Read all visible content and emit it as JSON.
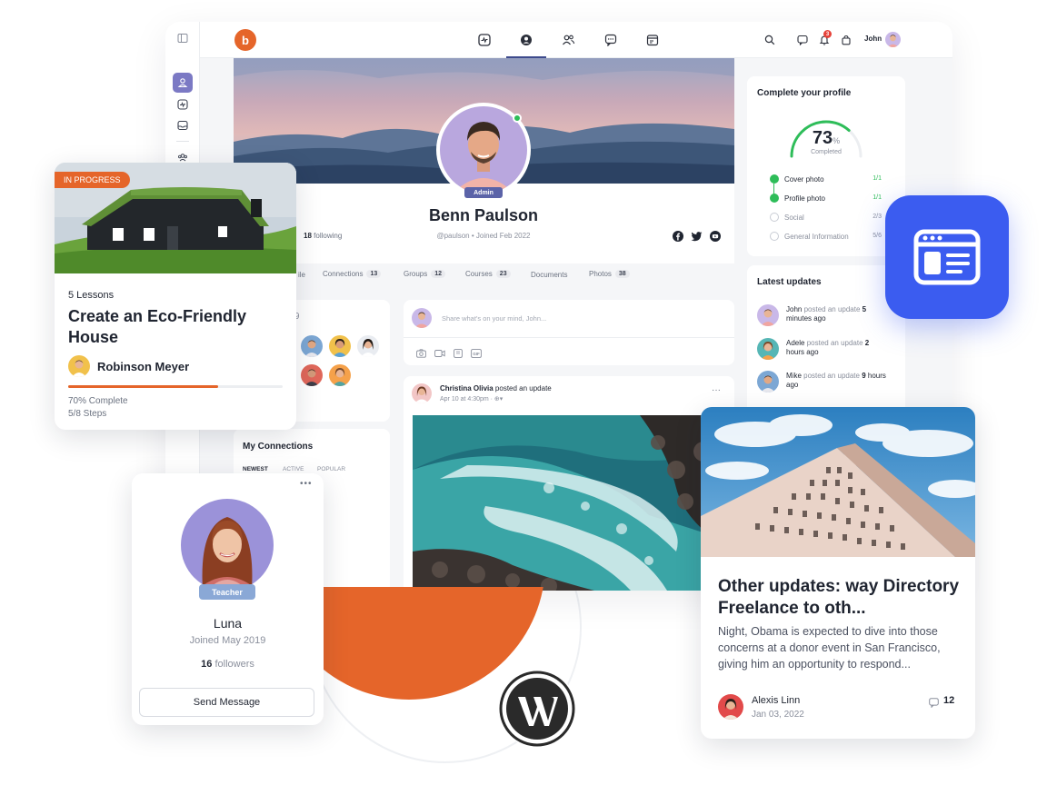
{
  "topbar": {
    "logo_letter": "b",
    "user_name": "John",
    "notification_count": "3"
  },
  "profile": {
    "name": "Benn Paulson",
    "handle": "@paulson",
    "joined": "Joined Feb 2022",
    "role_badge": "Admin",
    "following_count": "18",
    "following_label": "following"
  },
  "tabs": [
    {
      "label": "ile",
      "count": ""
    },
    {
      "label": "Connections",
      "count": "13"
    },
    {
      "label": "Groups",
      "count": "12"
    },
    {
      "label": "Courses",
      "count": "23"
    },
    {
      "label": "Documents",
      "count": ""
    },
    {
      "label": "Photos",
      "count": "38"
    }
  ],
  "following_widget": {
    "title_partial": "g",
    "count": "9"
  },
  "composer": {
    "placeholder": "Share what's on your mind, John..."
  },
  "post": {
    "author": "Christina Olivia",
    "action": "posted an update",
    "meta": "Apr 10 at 4:30pm",
    "menu": "···"
  },
  "connections_widget": {
    "title": "My Connections",
    "filters": [
      "NEWEST",
      "ACTIVE",
      "POPULAR"
    ]
  },
  "complete_profile": {
    "title": "Complete your profile",
    "percent": "73",
    "percent_sign": "%",
    "percent_value": 73,
    "completed_label": "Completed",
    "items": [
      {
        "label": "Cover photo",
        "progress": "1/1",
        "done": true
      },
      {
        "label": "Profile photo",
        "progress": "1/1",
        "done": true
      },
      {
        "label": "Social",
        "progress": "2/3",
        "done": false
      },
      {
        "label": "General Information",
        "progress": "5/6",
        "done": false
      }
    ]
  },
  "latest_updates": {
    "title": "Latest updates",
    "items": [
      {
        "name": "John",
        "text": "posted an update",
        "time_num": "5",
        "time_unit": "minutes ago"
      },
      {
        "name": "Adele",
        "text": "posted an update",
        "time_num": "2",
        "time_unit": "hours ago"
      },
      {
        "name": "Mike",
        "text": "posted an update",
        "time_num": "9",
        "time_unit": "hours ago"
      }
    ]
  },
  "course_card": {
    "status": "IN PROGRESS",
    "lessons": "5 Lessons",
    "title": "Create an Eco-Friendly House",
    "instructor": "Robinson Meyer",
    "progress_percent": 70,
    "progress_text": "70% Complete",
    "steps": "5/8 Steps"
  },
  "member_card": {
    "menu": "•••",
    "role": "Teacher",
    "name": "Luna",
    "joined": "Joined May 2019",
    "followers_count": "16",
    "followers_label": "followers",
    "button": "Send Message"
  },
  "blog_card": {
    "title": "Other updates: way Directory Freelance to oth...",
    "excerpt": "Night, Obama is expected to dive into those concerns at a donor event in San Francisco, giving him an opportunity to respond...",
    "author": "Alexis Linn",
    "date": "Jan 03, 2022",
    "comments": "12"
  },
  "colors": {
    "brand_orange": "#e5652a",
    "accent_blue": "#3b5cf0",
    "purple": "#7b79c4",
    "green": "#2ebd59"
  }
}
